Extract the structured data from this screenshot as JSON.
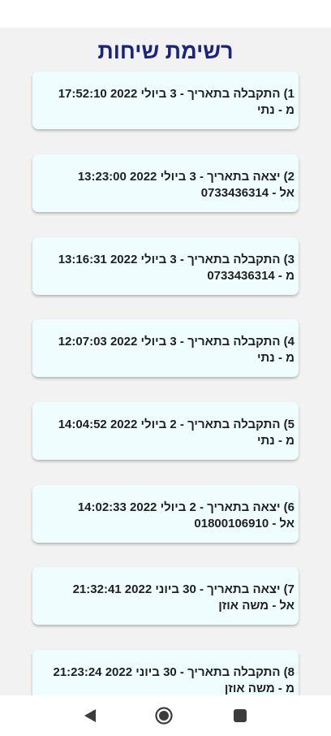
{
  "header": {
    "title": "רשימת שיחות"
  },
  "calls": [
    {
      "line1": "1) התקבלה בתאריך - 3 ביולי 2022 17:52:10",
      "line2": "מ - נתי"
    },
    {
      "line1": "2) יצאה בתאריך - 3 ביולי 2022 13:23:00",
      "line2": "אל - 0733436314"
    },
    {
      "line1": "3) התקבלה בתאריך - 3 ביולי 2022 13:16:31",
      "line2": "מ - 0733436314"
    },
    {
      "line1": "4) התקבלה בתאריך - 3 ביולי 2022 12:07:03",
      "line2": "מ - נתי"
    },
    {
      "line1": "5) התקבלה בתאריך - 2 ביולי 2022 14:04:52",
      "line2": "מ - נתי"
    },
    {
      "line1": "6) יצאה בתאריך - 2 ביולי 2022 14:02:33",
      "line2": "אל - 01800106910"
    },
    {
      "line1": "7) יצאה בתאריך - 30 ביוני 2022 21:32:41",
      "line2": "אל - משה אוזן"
    },
    {
      "line1": "8) התקבלה בתאריך - 30 ביוני 2022 21:23:24",
      "line2": "מ - משה אוזן"
    }
  ],
  "nav": {
    "back_icon": "back-triangle-icon",
    "home_icon": "home-circle-icon",
    "recents_icon": "recents-square-icon"
  },
  "colors": {
    "title": "#1a237e",
    "card_bg": "#f0fdff",
    "screen_bg": "#f2f2f2"
  }
}
